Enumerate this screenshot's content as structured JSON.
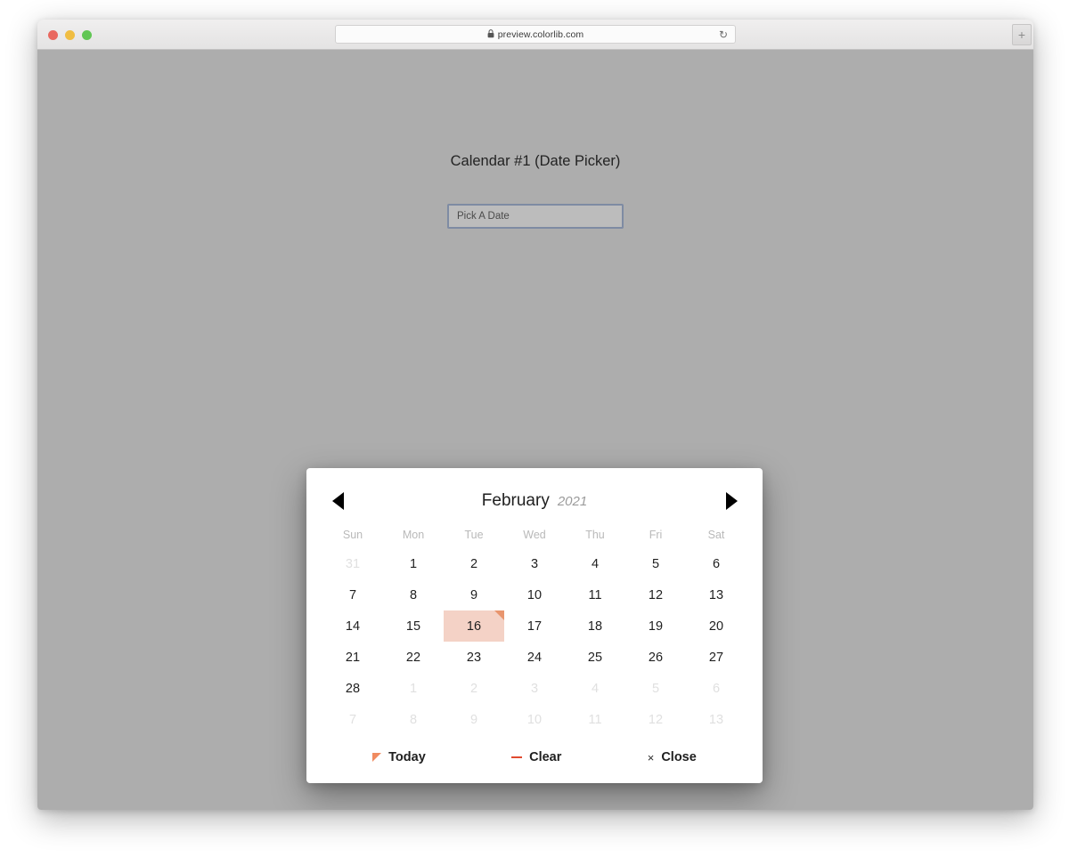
{
  "browser": {
    "url": "preview.colorlib.com",
    "lock_icon": "lock-icon",
    "reload_icon": "reload-icon",
    "new_tab_label": "+",
    "traffic_lights": [
      "close-red",
      "minimize-yellow",
      "maximize-green"
    ]
  },
  "page": {
    "title": "Calendar #1 (Date Picker)",
    "background_color": "#adadad"
  },
  "date_input": {
    "placeholder": "Pick A Date",
    "value": "",
    "focus_border_color": "#7e8ba3"
  },
  "calendar": {
    "month": "February",
    "year": "2021",
    "prev_icon": "triangle-left-icon",
    "next_icon": "triangle-right-icon",
    "weekdays": [
      "Sun",
      "Mon",
      "Tue",
      "Wed",
      "Thu",
      "Fri",
      "Sat"
    ],
    "selected_day": 16,
    "selected_bg_color": "#f4d2c6",
    "today_corner_color": "#e8956e",
    "weeks": [
      [
        {
          "label": "31",
          "muted": true
        },
        {
          "label": "1",
          "muted": false
        },
        {
          "label": "2",
          "muted": false
        },
        {
          "label": "3",
          "muted": false
        },
        {
          "label": "4",
          "muted": false
        },
        {
          "label": "5",
          "muted": false
        },
        {
          "label": "6",
          "muted": false
        }
      ],
      [
        {
          "label": "7",
          "muted": false
        },
        {
          "label": "8",
          "muted": false
        },
        {
          "label": "9",
          "muted": false
        },
        {
          "label": "10",
          "muted": false
        },
        {
          "label": "11",
          "muted": false
        },
        {
          "label": "12",
          "muted": false
        },
        {
          "label": "13",
          "muted": false
        }
      ],
      [
        {
          "label": "14",
          "muted": false
        },
        {
          "label": "15",
          "muted": false
        },
        {
          "label": "16",
          "muted": false,
          "selected": true,
          "today": true
        },
        {
          "label": "17",
          "muted": false
        },
        {
          "label": "18",
          "muted": false
        },
        {
          "label": "19",
          "muted": false
        },
        {
          "label": "20",
          "muted": false
        }
      ],
      [
        {
          "label": "21",
          "muted": false
        },
        {
          "label": "22",
          "muted": false
        },
        {
          "label": "23",
          "muted": false
        },
        {
          "label": "24",
          "muted": false
        },
        {
          "label": "25",
          "muted": false
        },
        {
          "label": "26",
          "muted": false
        },
        {
          "label": "27",
          "muted": false
        }
      ],
      [
        {
          "label": "28",
          "muted": false
        },
        {
          "label": "1",
          "muted": true
        },
        {
          "label": "2",
          "muted": true
        },
        {
          "label": "3",
          "muted": true
        },
        {
          "label": "4",
          "muted": true
        },
        {
          "label": "5",
          "muted": true
        },
        {
          "label": "6",
          "muted": true
        }
      ],
      [
        {
          "label": "7",
          "muted": true
        },
        {
          "label": "8",
          "muted": true
        },
        {
          "label": "9",
          "muted": true
        },
        {
          "label": "10",
          "muted": true
        },
        {
          "label": "11",
          "muted": true
        },
        {
          "label": "12",
          "muted": true
        },
        {
          "label": "13",
          "muted": true
        }
      ]
    ],
    "footer": {
      "today_label": "Today",
      "today_icon": "triangle-corner-icon",
      "today_icon_color": "#f08b60",
      "clear_label": "Clear",
      "clear_icon": "minus-icon",
      "clear_icon_color": "#e04a2f",
      "close_label": "Close",
      "close_icon": "close-x-icon",
      "close_icon_glyph": "×"
    }
  }
}
